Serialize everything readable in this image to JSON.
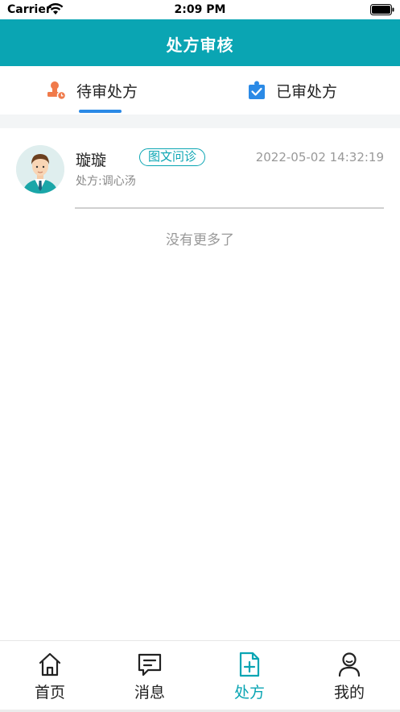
{
  "status_bar": {
    "carrier": "Carrier",
    "time": "2:09 PM"
  },
  "header": {
    "title": "处方审核"
  },
  "tabs": [
    {
      "label": "待审处方",
      "icon": "stamp-icon",
      "active": true
    },
    {
      "label": "已审处方",
      "icon": "clipboard-check-icon",
      "active": false
    }
  ],
  "prescriptions": [
    {
      "patient_name": "璇璇",
      "consult_type": "图文问诊",
      "time": "2022-05-02 14:32:19",
      "rx_prefix": "处方:",
      "rx_name": "调心汤",
      "avatar": "doctor-avatar"
    }
  ],
  "list_footer": "没有更多了",
  "tabbar": [
    {
      "label": "首页",
      "icon": "home-icon",
      "active": false
    },
    {
      "label": "消息",
      "icon": "message-icon",
      "active": false
    },
    {
      "label": "处方",
      "icon": "prescription-icon",
      "active": true
    },
    {
      "label": "我的",
      "icon": "profile-icon",
      "active": false
    }
  ],
  "colors": {
    "brand": "#0aa5b3",
    "tab_indicator": "#2b8ae6",
    "pending_icon": "#f07a4a",
    "reviewed_icon": "#2b8ae6"
  }
}
